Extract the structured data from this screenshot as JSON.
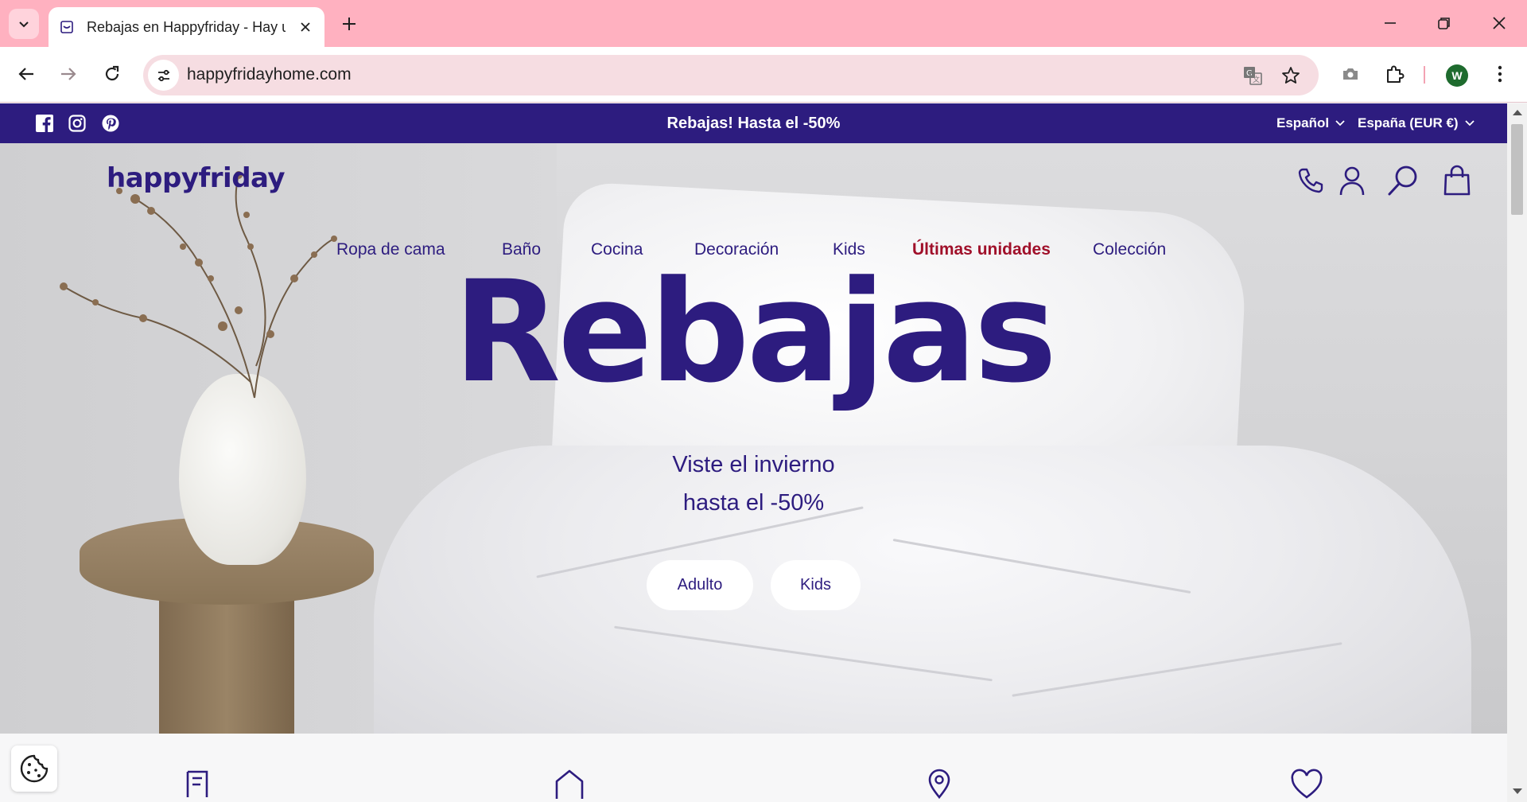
{
  "browser": {
    "tab_title": "Rebajas en Happyfriday - Hay u",
    "url": "happyfridayhome.com",
    "profile_initial": "W",
    "icons": [
      "tab-list-icon",
      "favicon-icon",
      "close-tab-icon",
      "new-tab-icon",
      "minimize-icon",
      "restore-icon",
      "close-window-icon",
      "back-icon",
      "forward-icon",
      "reload-icon",
      "site-info-icon",
      "translate-icon",
      "bookmark-star-icon",
      "screenshot-icon",
      "extensions-icon",
      "menu-icon"
    ]
  },
  "promo_bar": {
    "text": "Rebajas! Hasta el -50%",
    "language": "Español",
    "currency": "España (EUR €)",
    "social": [
      "facebook-icon",
      "instagram-icon",
      "pinterest-icon"
    ]
  },
  "header": {
    "logo": "happyfriday",
    "icons": [
      "phone-icon",
      "account-icon",
      "search-icon",
      "cart-icon"
    ]
  },
  "nav": {
    "items": [
      {
        "label": "Ropa de cama"
      },
      {
        "label": "Baño"
      },
      {
        "label": "Cocina"
      },
      {
        "label": "Decoración"
      },
      {
        "label": "Kids"
      },
      {
        "label": "Últimas unidades"
      },
      {
        "label": "Colección"
      }
    ]
  },
  "hero": {
    "title": "Rebajas",
    "subtitle_line1": "Viste el invierno",
    "subtitle_line2": "hasta el -50%",
    "buttons": [
      {
        "label": "Adulto"
      },
      {
        "label": "Kids"
      }
    ]
  },
  "features": {
    "icons": [
      "receipt-icon",
      "home-icon",
      "location-pin-icon",
      "heart-icon"
    ]
  },
  "cookie": {
    "icon": "cookie-icon"
  },
  "colors": {
    "brand": "#2d1c7f",
    "sale": "#a0102a",
    "tabbar": "#ffb1c0"
  }
}
